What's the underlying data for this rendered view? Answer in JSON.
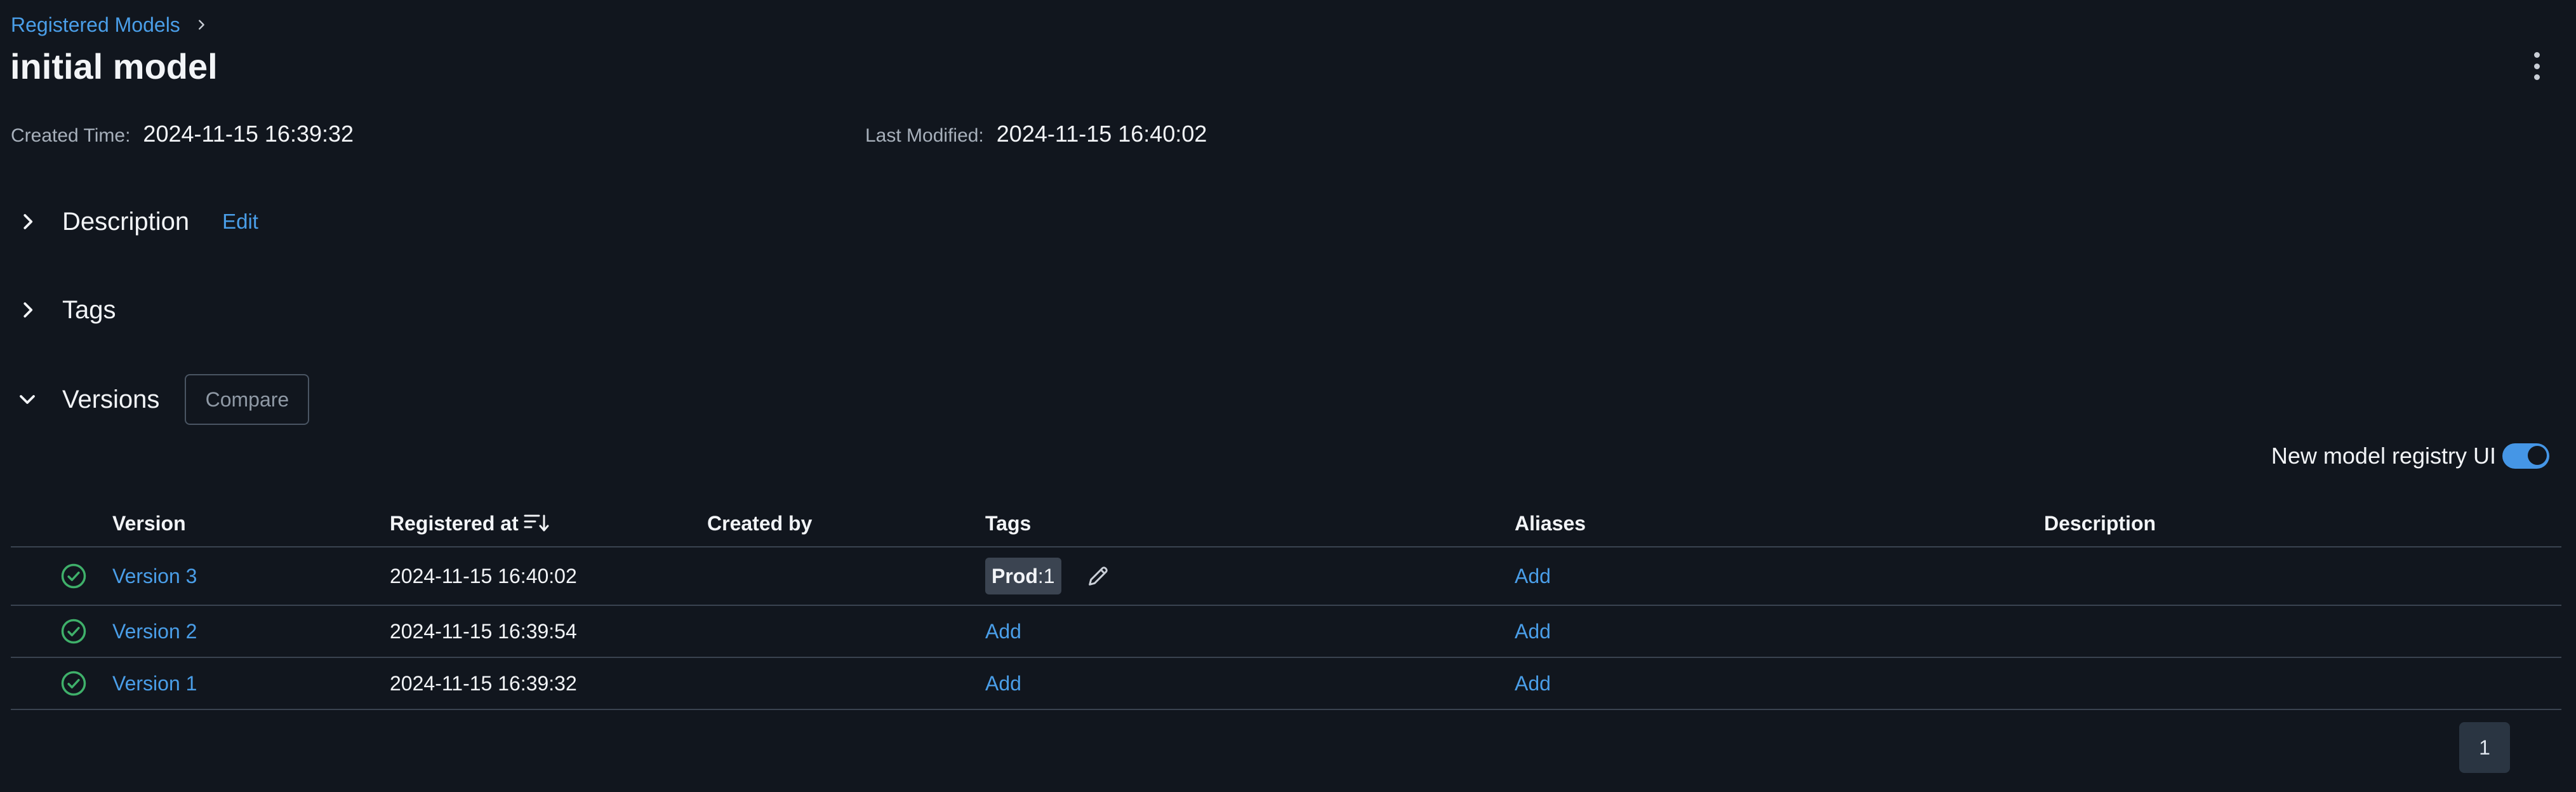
{
  "breadcrumb": {
    "parent_label": "Registered Models"
  },
  "page_title": "initial model",
  "metadata": {
    "created_label": "Created Time:",
    "created_value": "2024-11-15 16:39:32",
    "modified_label": "Last Modified:",
    "modified_value": "2024-11-15 16:40:02"
  },
  "sections": {
    "description": {
      "title": "Description",
      "edit_label": "Edit",
      "expanded": false
    },
    "tags": {
      "title": "Tags",
      "expanded": false
    },
    "versions": {
      "title": "Versions",
      "compare_label": "Compare",
      "expanded": true
    }
  },
  "registry_toggle": {
    "label": "New model registry UI",
    "enabled": true
  },
  "table": {
    "headers": {
      "version": "Version",
      "registered_at": "Registered at",
      "created_by": "Created by",
      "tags": "Tags",
      "aliases": "Aliases",
      "description": "Description"
    },
    "rows": [
      {
        "version": "Version 3",
        "registered_at": "2024-11-15 16:40:02",
        "created_by": "",
        "tag_key": "Prod",
        "tag_sep": ": ",
        "tag_value": "1",
        "aliases": "Add",
        "description": ""
      },
      {
        "version": "Version 2",
        "registered_at": "2024-11-15 16:39:54",
        "created_by": "",
        "tags_add": "Add",
        "aliases": "Add",
        "description": ""
      },
      {
        "version": "Version 1",
        "registered_at": "2024-11-15 16:39:32",
        "created_by": "",
        "tags_add": "Add",
        "aliases": "Add",
        "description": ""
      }
    ]
  },
  "pagination": {
    "current_page": "1"
  },
  "icons": {
    "breadcrumb_separator": "chevron-right-icon",
    "menu": "kebab-menu-icon",
    "collapsed": "chevron-right-icon",
    "expanded": "chevron-down-icon",
    "sort": "sort-descending-icon",
    "status": "check-circle-icon",
    "edit_tags": "pencil-icon"
  },
  "colors": {
    "background": "#11161e",
    "link": "#4a9ee8",
    "status_ready": "#3fb06a",
    "toggle_on": "#4596e6",
    "divider": "#3a4350"
  }
}
